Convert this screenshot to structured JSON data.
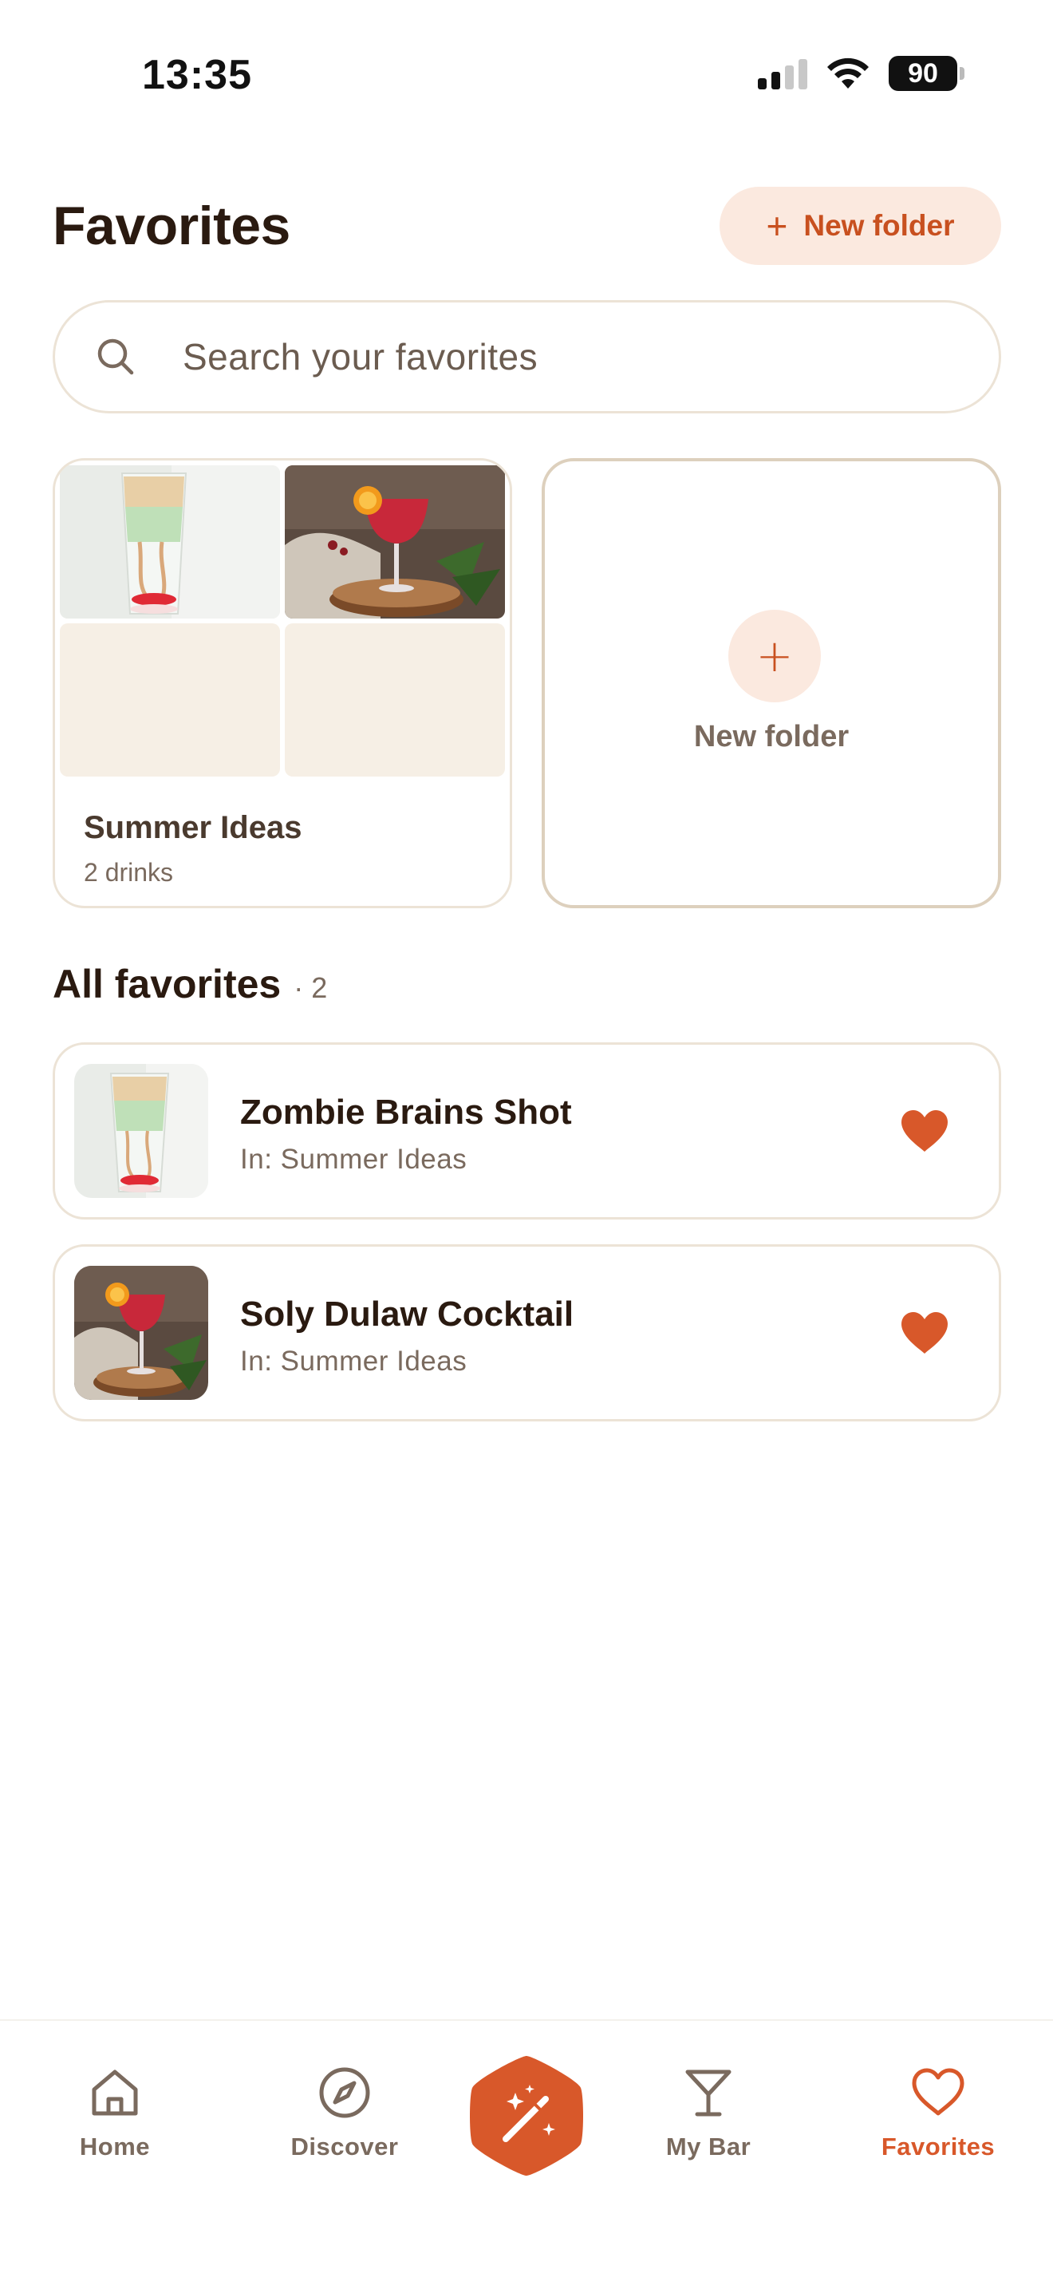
{
  "status_bar": {
    "time": "13:35",
    "battery": "90",
    "signal_icon": "cellular-signal-icon",
    "wifi_icon": "wifi-icon"
  },
  "header": {
    "title": "Favorites",
    "new_folder_button": "New folder",
    "new_folder_button_icon": "plus-icon"
  },
  "search": {
    "placeholder": "Search your favorites",
    "icon": "search-icon"
  },
  "folders": [
    {
      "name": "Summer Ideas",
      "count": "2 drinks"
    }
  ],
  "new_folder_card": {
    "label": "New folder",
    "icon": "plus-icon"
  },
  "all_favorites": {
    "title": "All favorites",
    "count": "· 2",
    "items": [
      {
        "name": "Zombie Brains Shot",
        "folder": "In: Summer Ideas",
        "favorited": true
      },
      {
        "name": "Soly Dulaw Cocktail",
        "folder": "In: Summer Ideas",
        "favorited": true
      }
    ]
  },
  "bottom_nav": {
    "items": [
      {
        "label": "Home",
        "icon": "home-icon"
      },
      {
        "label": "Discover",
        "icon": "compass-icon"
      },
      {
        "label": "",
        "icon": "magic-wand-icon"
      },
      {
        "label": "My Bar",
        "icon": "cocktail-glass-icon"
      },
      {
        "label": "Favorites",
        "icon": "heart-icon",
        "active": true
      }
    ]
  },
  "colors": {
    "accent": "#d8582a",
    "accent_soft": "#fbe9df",
    "text_dark": "#2a1a10",
    "text_muted": "#7a6a5e",
    "border": "#ece3d6"
  }
}
